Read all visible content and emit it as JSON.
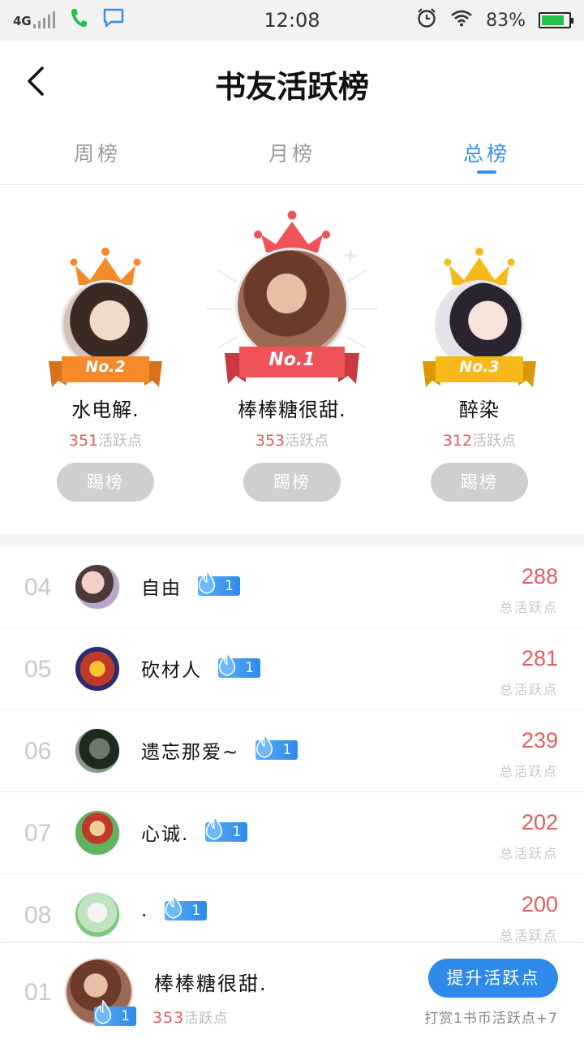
{
  "status_bar": {
    "network": "4G",
    "time": "12:08",
    "battery": "83%",
    "battery_level": 0.83,
    "icons": [
      "signal-icon",
      "phone-icon",
      "message-icon",
      "alarm-icon",
      "wifi-icon",
      "battery-icon"
    ]
  },
  "header": {
    "title": "书友活跃榜",
    "back_icon": "chevron-left-icon"
  },
  "tabs": [
    {
      "label": "周榜",
      "active": false
    },
    {
      "label": "月榜",
      "active": false
    },
    {
      "label": "总榜",
      "active": true
    }
  ],
  "podium": {
    "first": {
      "rank_label": "No.1",
      "name": "棒棒糖很甜.",
      "points": "353",
      "points_unit": "活跃点",
      "button": "踢榜",
      "crown_color": "#f0525a"
    },
    "second": {
      "rank_label": "No.2",
      "name": "水电解.",
      "points": "351",
      "points_unit": "活跃点",
      "button": "踢榜",
      "crown_color": "#f58a2a"
    },
    "third": {
      "rank_label": "No.3",
      "name": "醉染",
      "points": "312",
      "points_unit": "活跃点",
      "button": "踢榜",
      "crown_color": "#f7b919"
    }
  },
  "list": [
    {
      "rank": "04",
      "name": "自由",
      "level": "1",
      "score": "288",
      "score_label": "总活跃点"
    },
    {
      "rank": "05",
      "name": "砍材人",
      "level": "1",
      "score": "281",
      "score_label": "总活跃点"
    },
    {
      "rank": "06",
      "name": "遗忘那爱~",
      "level": "1",
      "score": "239",
      "score_label": "总活跃点"
    },
    {
      "rank": "07",
      "name": "心诚.",
      "level": "1",
      "score": "202",
      "score_label": "总活跃点"
    },
    {
      "rank": "08",
      "name": ".",
      "level": "1",
      "score": "200",
      "score_label": "总活跃点"
    }
  ],
  "my_rank": {
    "rank": "01",
    "name": "棒棒糖很甜.",
    "level": "1",
    "points": "353",
    "points_unit": "活跃点",
    "button": "提升活跃点",
    "hint": "打赏1书币活跃点+7"
  },
  "colors": {
    "accent": "#2d8ae8",
    "score_red": "#e25d5d",
    "muted": "#c7c7c7"
  }
}
